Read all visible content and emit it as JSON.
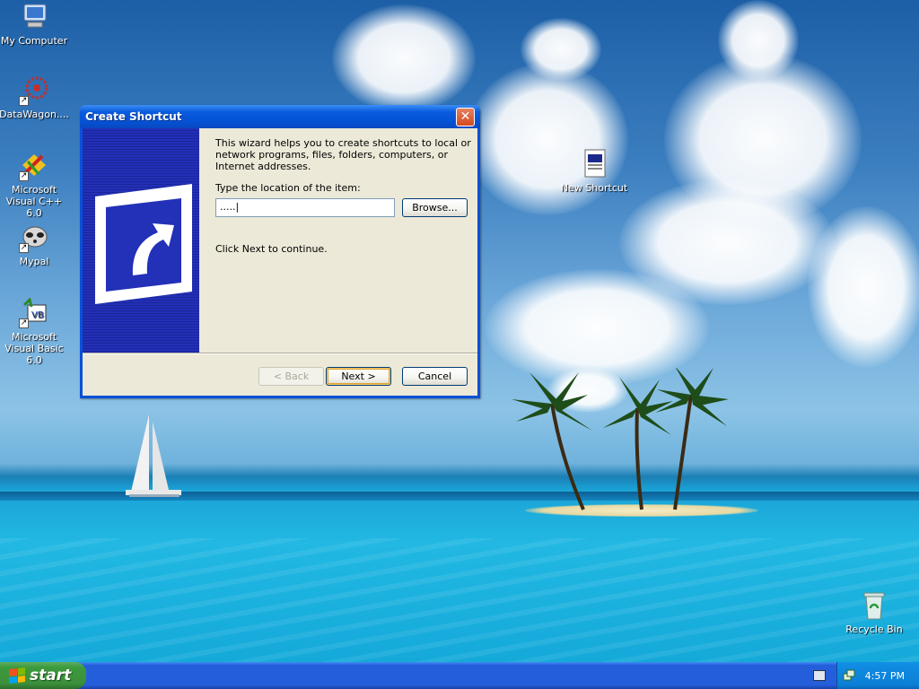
{
  "desktop": {
    "icons": [
      {
        "label": "My Computer",
        "icon": "my-computer-icon"
      },
      {
        "label": "DataWagon....",
        "icon": "datawagon-icon"
      },
      {
        "label": "Microsoft Visual C++ 6.0",
        "icon": "visual-cpp-icon"
      },
      {
        "label": "Mypal",
        "icon": "mypal-icon"
      },
      {
        "label": "Microsoft Visual Basic 6.0",
        "icon": "visual-basic-icon"
      },
      {
        "label": "New Shortcut",
        "icon": "new-shortcut-icon"
      },
      {
        "label": "Recycle Bin",
        "icon": "recycle-bin-icon"
      }
    ]
  },
  "dialog": {
    "title": "Create Shortcut",
    "close_label": "✕",
    "intro": "This wizard helps you to create shortcuts to local or network programs, files, folders, computers, or Internet addresses.",
    "location_label": "Type the location of the item:",
    "location_value": ".....|",
    "browse_label": "Browse...",
    "continue_text": "Click Next to continue.",
    "back_label": "< Back",
    "next_label": "Next >",
    "cancel_label": "Cancel"
  },
  "taskbar": {
    "start_label": "start",
    "clock": "4:57 PM"
  },
  "colors": {
    "title_bar": "#0a5bde",
    "banner": "#2330b8",
    "start_button": "#3c9a3c",
    "tray": "#0f8ae0"
  }
}
